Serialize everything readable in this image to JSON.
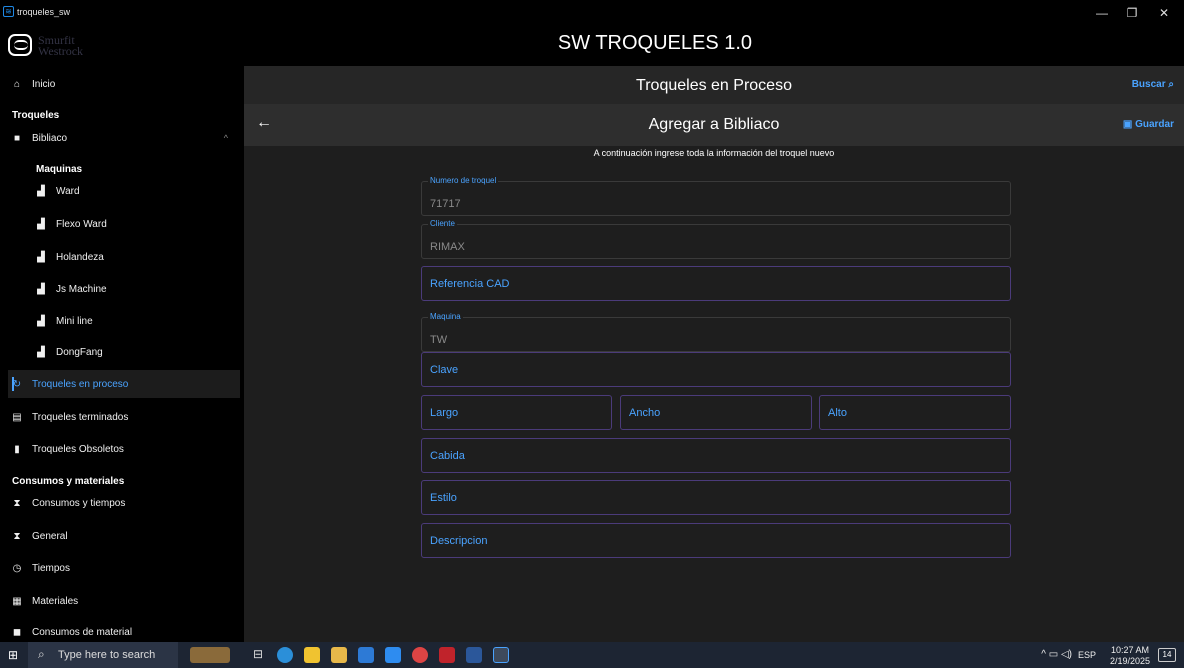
{
  "window": {
    "title": "troqueles_sw",
    "controls": [
      "—",
      "❐",
      "✕"
    ]
  },
  "header": {
    "logo_line1": "Smurfit",
    "logo_line2": "Westrock",
    "app_title": "SW TROQUELES 1.0"
  },
  "sidebar": {
    "inicio": "Inicio",
    "section_troqueles": "Troqueles",
    "bibliaco": "Bibliaco",
    "maquinas_head": "Maquinas",
    "machines": [
      "Ward",
      "Flexo Ward",
      "Holandeza",
      "Js Machine",
      "Mini line",
      "DongFang"
    ],
    "proceso": "Troqueles en proceso",
    "terminados": "Troqueles terminados",
    "obsoletos": "Troqueles Obsoletos",
    "section_consumos": "Consumos  y materiales",
    "consumos": "Consumos y tiempos",
    "general": "General",
    "tiempos": "Tiempos",
    "materiales": "Materiales",
    "consumos_material": "Consumos de material"
  },
  "topbar": {
    "title": "Troqueles en Proceso",
    "search": "Buscar"
  },
  "form": {
    "title": "Agregar a Bibliaco",
    "save": "Guardar",
    "subtitle": "A continuación ingrese toda la información del troquel nuevo",
    "numero_label": "Numero de troquel",
    "numero_value": "71717",
    "cliente_label": "Cliente",
    "cliente_value": "RIMAX",
    "referencia": "Referencia CAD",
    "maquina_label": "Maquina",
    "maquina_value": "TW",
    "clave": "Clave",
    "largo": "Largo",
    "ancho": "Ancho",
    "alto": "Alto",
    "cabida": "Cabida",
    "estilo": "Estilo",
    "descripcion": "Descripcion"
  },
  "taskbar": {
    "search_placeholder": "Type here to search",
    "language": "ESP",
    "time": "10:27 AM",
    "date": "2/19/2025",
    "notifications": "14"
  }
}
